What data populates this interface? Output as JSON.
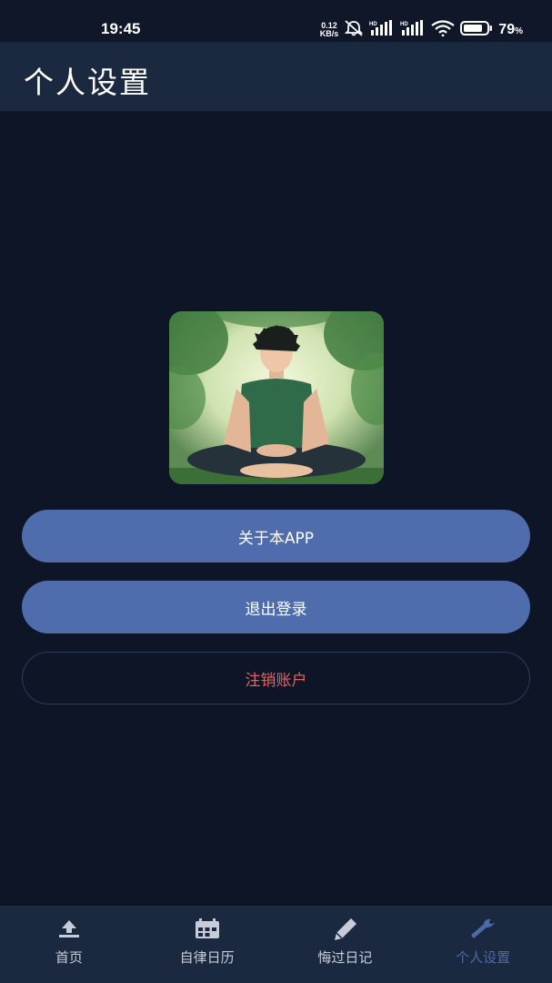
{
  "status_bar": {
    "time": "19:45",
    "net_speed_value": "0.12",
    "net_speed_unit": "KB/s",
    "hd1": "HD",
    "hd2": "HD",
    "battery_percent": "79",
    "battery_percent_sign": "%",
    "icons": [
      "mute-icon",
      "signal-icon",
      "signal-icon",
      "wifi-icon",
      "battery-icon"
    ]
  },
  "header": {
    "title": "个人设置"
  },
  "main": {
    "avatar_description": "avatar-image",
    "buttons": {
      "about": "关于本APP",
      "logout": "退出登录",
      "delete_account": "注销账户"
    }
  },
  "bottom_nav": {
    "items": [
      {
        "label": "首页",
        "icon": "upload-icon",
        "active": false
      },
      {
        "label": "自律日历",
        "icon": "calendar-icon",
        "active": false
      },
      {
        "label": "悔过日记",
        "icon": "pen-icon",
        "active": false
      },
      {
        "label": "个人设置",
        "icon": "wrench-icon",
        "active": true
      }
    ]
  },
  "colors": {
    "background": "#0e1527",
    "bar": "#1b2940",
    "primary": "#4f6dad",
    "danger": "#e26363",
    "active_nav": "#4d6aa8"
  }
}
